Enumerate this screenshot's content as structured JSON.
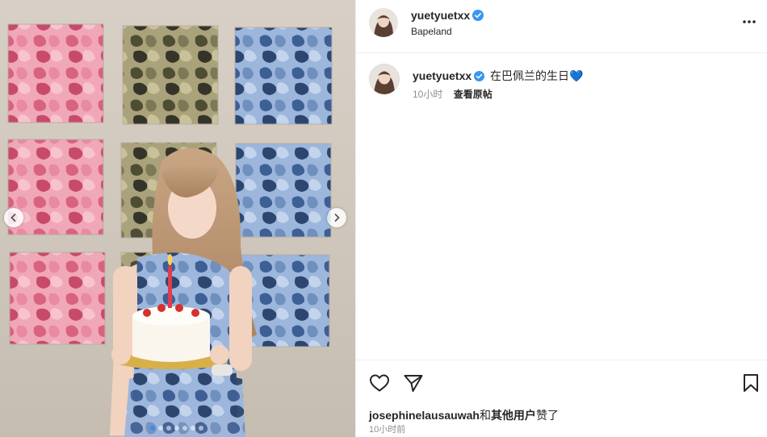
{
  "post": {
    "username": "yuetyuetxx",
    "location": "Bapeland",
    "verified": true
  },
  "caption": {
    "username": "yuetyuetxx",
    "text": "在巴佩兰的生日💙",
    "age": "10小时",
    "translate_label": "查看原帖"
  },
  "likes": {
    "first_user": "josephinelausauwah",
    "connector": "和",
    "others": "其他用户",
    "suffix": "赞了"
  },
  "timestamp": "10小时前",
  "carousel": {
    "count": 7,
    "active_index": 0
  },
  "colors": {
    "verified": "#3897f0",
    "pink_camo": "#e88fa6",
    "green_camo": "#6e6b4c",
    "blue_camo": "#6f90bf"
  },
  "icons": {
    "more": "more-horizontal-icon",
    "like": "heart-icon",
    "share": "paper-plane-icon",
    "save": "bookmark-icon",
    "prev": "chevron-left-icon",
    "next": "chevron-right-icon"
  }
}
